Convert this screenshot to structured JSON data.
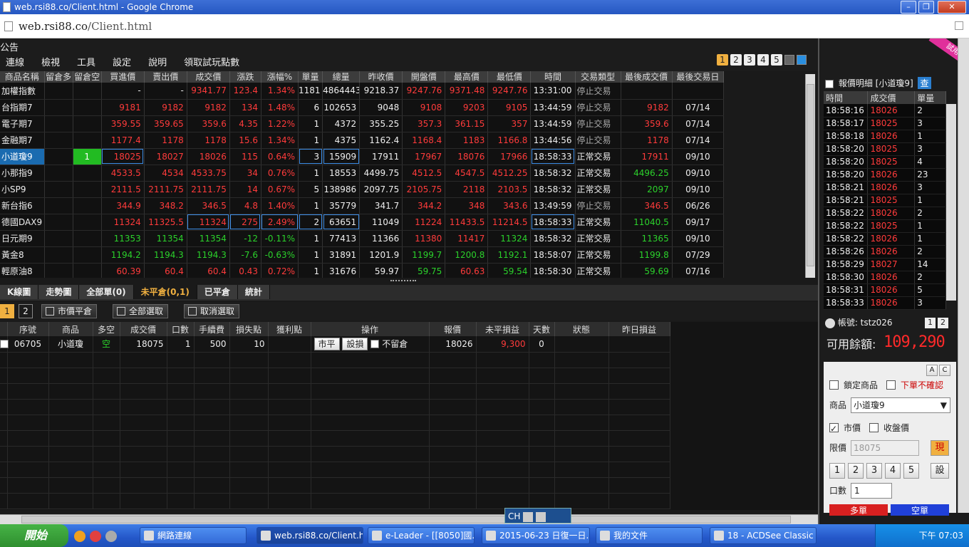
{
  "window": {
    "title": "web.rsi88.co/Client.html - Google Chrome",
    "url_host": "web.rsi88.co",
    "url_path": "/Client.html"
  },
  "app": {
    "title": "公告",
    "menu": [
      "連線",
      "檢視",
      "工具",
      "設定",
      "說明",
      "領取試玩點數"
    ],
    "layout_pages": [
      "1",
      "2",
      "3",
      "4",
      "5"
    ]
  },
  "quote": {
    "headers": [
      "商品名稱",
      "留倉多",
      "留倉空",
      "買進價",
      "賣出價",
      "成交價",
      "漲跌",
      "漲幅%",
      "單量",
      "總量",
      "昨收價",
      "開盤價",
      "最高價",
      "最低價",
      "時間",
      "交易類型",
      "最後成交價",
      "最後交易日"
    ],
    "rows": [
      [
        "加權指數",
        "",
        "",
        "-",
        "-",
        "9341.77",
        "123.4",
        "1.34%",
        "1181",
        "4864443",
        "9218.37",
        "9247.76",
        "9371.48",
        "9247.76",
        "13:31:00",
        "停止交易",
        "",
        ""
      ],
      [
        "台指期7",
        "",
        "",
        "9181",
        "9182",
        "9182",
        "134",
        "1.48%",
        "6",
        "102653",
        "9048",
        "9108",
        "9203",
        "9105",
        "13:44:59",
        "停止交易",
        "9182",
        "07/14"
      ],
      [
        "電子期7",
        "",
        "",
        "359.55",
        "359.65",
        "359.6",
        "4.35",
        "1.22%",
        "1",
        "4372",
        "355.25",
        "357.3",
        "361.15",
        "357",
        "13:44:59",
        "停止交易",
        "359.6",
        "07/14"
      ],
      [
        "金融期7",
        "",
        "",
        "1177.4",
        "1178",
        "1178",
        "15.6",
        "1.34%",
        "1",
        "4375",
        "1162.4",
        "1168.4",
        "1183",
        "1166.8",
        "13:44:56",
        "停止交易",
        "1178",
        "07/14"
      ],
      [
        "小道瓊9",
        "",
        "1",
        "18025",
        "18027",
        "18026",
        "115",
        "0.64%",
        "3",
        "15909",
        "17911",
        "17967",
        "18076",
        "17966",
        "18:58:33",
        "正常交易",
        "17911",
        "09/10"
      ],
      [
        "小那指9",
        "",
        "",
        "4533.5",
        "4534",
        "4533.75",
        "34",
        "0.76%",
        "1",
        "18553",
        "4499.75",
        "4512.5",
        "4547.5",
        "4512.25",
        "18:58:32",
        "正常交易",
        "4496.25",
        "09/10"
      ],
      [
        "小SP9",
        "",
        "",
        "2111.5",
        "2111.75",
        "2111.75",
        "14",
        "0.67%",
        "5",
        "138986",
        "2097.75",
        "2105.75",
        "2118",
        "2103.5",
        "18:58:32",
        "正常交易",
        "2097",
        "09/10"
      ],
      [
        "新台指6",
        "",
        "",
        "344.9",
        "348.2",
        "346.5",
        "4.8",
        "1.40%",
        "1",
        "35779",
        "341.7",
        "344.2",
        "348",
        "343.6",
        "13:49:59",
        "停止交易",
        "346.5",
        "06/26"
      ],
      [
        "德國DAX9",
        "",
        "",
        "11324",
        "11325.5",
        "11324",
        "275",
        "2.49%",
        "2",
        "63651",
        "11049",
        "11224",
        "11433.5",
        "11214.5",
        "18:58:33",
        "正常交易",
        "11040.5",
        "09/17"
      ],
      [
        "日元期9",
        "",
        "",
        "11353",
        "11354",
        "11354",
        "-12",
        "-0.11%",
        "1",
        "77413",
        "11366",
        "11380",
        "11417",
        "11324",
        "18:58:32",
        "正常交易",
        "11365",
        "09/10"
      ],
      [
        "黃金8",
        "",
        "",
        "1194.2",
        "1194.3",
        "1194.3",
        "-7.6",
        "-0.63%",
        "1",
        "31891",
        "1201.9",
        "1199.7",
        "1200.8",
        "1192.1",
        "18:58:07",
        "正常交易",
        "1199.8",
        "07/29"
      ],
      [
        "輕原油8",
        "",
        "",
        "60.39",
        "60.4",
        "60.4",
        "0.43",
        "0.72%",
        "1",
        "31676",
        "59.97",
        "59.75",
        "60.63",
        "59.54",
        "18:58:30",
        "正常交易",
        "59.69",
        "07/16"
      ]
    ]
  },
  "tabs": [
    "K線圖",
    "走勢圖",
    "全部單(0)",
    "未平倉(0,1)",
    "已平倉",
    "統計"
  ],
  "toolbar": {
    "page1": "1",
    "page2": "2",
    "close_market": "市價平倉",
    "select_all": "全部選取",
    "deselect": "取消選取"
  },
  "positions": {
    "headers": [
      "序號",
      "商品",
      "多空",
      "成交價",
      "口數",
      "手續費",
      "損失點",
      "獲利點",
      "操作",
      "報價",
      "未平損益",
      "天數",
      "狀態",
      "昨日損益"
    ],
    "rows": [
      {
        "seq": "06705",
        "product": "小道瓊",
        "side": "空",
        "price": "18075",
        "qty": "1",
        "fee": "500",
        "stop": "10",
        "profit": "",
        "btn1": "市平",
        "btn2": "設損",
        "keep": "不留倉",
        "quote": "18026",
        "pnl": "9,300",
        "days": "0",
        "status": "",
        "yday": ""
      }
    ]
  },
  "ticks": {
    "title": "報價明細 [小道瓊9]",
    "query_btn": "查",
    "headers": [
      "時間",
      "成交價",
      "單量"
    ],
    "rows": [
      [
        "18:58:16",
        "18026",
        "2"
      ],
      [
        "18:58:17",
        "18025",
        "3"
      ],
      [
        "18:58:18",
        "18026",
        "1"
      ],
      [
        "18:58:20",
        "18025",
        "3"
      ],
      [
        "18:58:20",
        "18025",
        "4"
      ],
      [
        "18:58:20",
        "18026",
        "23"
      ],
      [
        "18:58:21",
        "18026",
        "3"
      ],
      [
        "18:58:21",
        "18025",
        "1"
      ],
      [
        "18:58:22",
        "18026",
        "2"
      ],
      [
        "18:58:22",
        "18025",
        "1"
      ],
      [
        "18:58:22",
        "18026",
        "1"
      ],
      [
        "18:58:26",
        "18026",
        "2"
      ],
      [
        "18:58:29",
        "18027",
        "14"
      ],
      [
        "18:58:30",
        "18026",
        "2"
      ],
      [
        "18:58:31",
        "18026",
        "5"
      ],
      [
        "18:58:33",
        "18026",
        "3"
      ]
    ]
  },
  "ribbon": "試用帳號",
  "account": {
    "label": "帳號: tstz026",
    "p1": "1",
    "p2": "2",
    "avail_label": "可用餘額:",
    "avail_value": "109,290"
  },
  "order": {
    "a": "A",
    "c": "C",
    "lock": "鎖定商品",
    "noconfirm": "下單不確認",
    "product_label": "商品",
    "product_value": "小道瓊9",
    "market": "市價",
    "close": "收盤價",
    "limit_label": "限價",
    "limit_value": "18075",
    "now": "現",
    "qty_btns": [
      "1",
      "2",
      "3",
      "4",
      "5"
    ],
    "set": "設",
    "qty_label": "口數",
    "qty_value": "1",
    "buy": "多單",
    "sell": "空單"
  },
  "ime": "CH",
  "taskbar": {
    "start": "開始",
    "tasks": [
      "網路連線",
      "web.rsi88.co/Client.ht...",
      "e-Leader - [[8050]國...",
      "2015-06-23 日復一日...",
      "我的文件",
      "18 - ACDSee Classic [..."
    ],
    "clock": "下午 07:03"
  },
  "colors": {
    "up": "#ff3b3b",
    "down": "#2bd12b",
    "accent": "#f0b040",
    "select": "#1a6bb0"
  }
}
